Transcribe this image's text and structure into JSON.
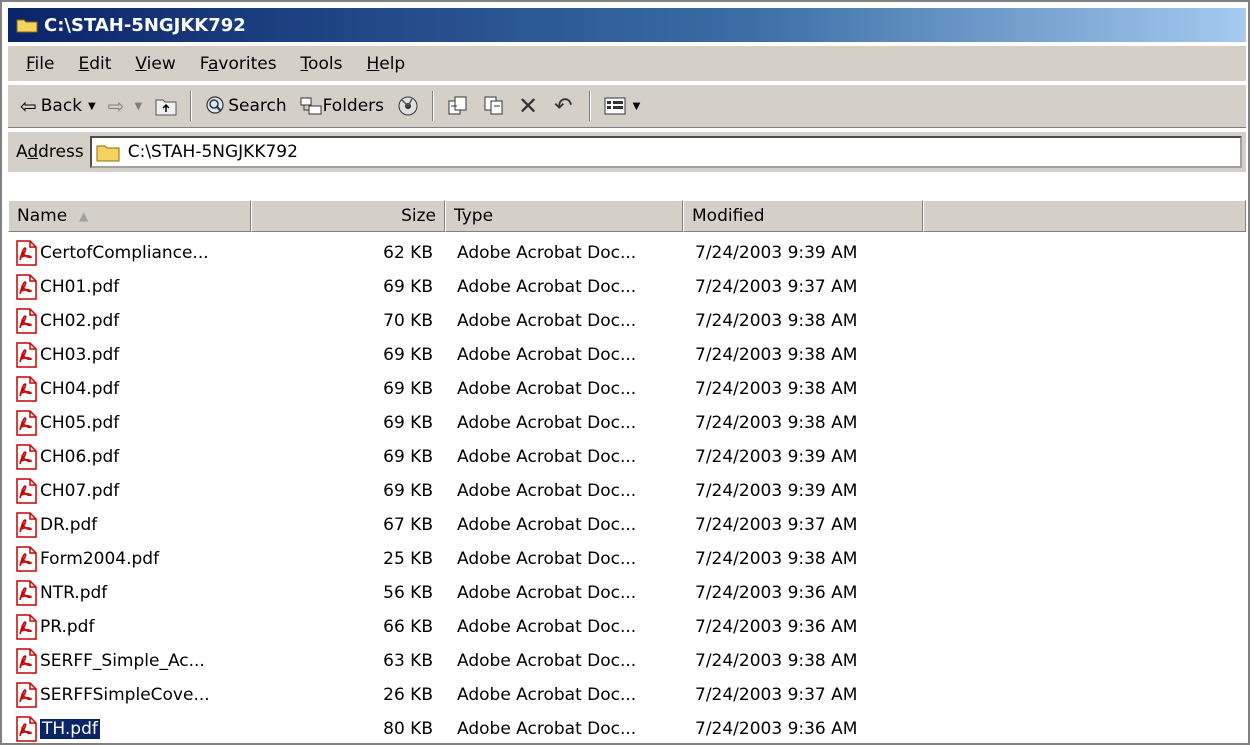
{
  "window": {
    "title": "C:\\STAH-5NGJKK792"
  },
  "menubar": {
    "items": [
      {
        "ul": "F",
        "rest": "ile"
      },
      {
        "ul": "E",
        "rest": "dit"
      },
      {
        "ul": "V",
        "rest": "iew"
      },
      {
        "pre": "F",
        "ul": "a",
        "rest": "vorites"
      },
      {
        "ul": "T",
        "rest": "ools"
      },
      {
        "ul": "H",
        "rest": "elp"
      }
    ]
  },
  "toolbar": {
    "back_label": "Back",
    "search_label": "Search",
    "folders_label": "Folders"
  },
  "address": {
    "label_pre": "A",
    "label_ul": "d",
    "label_rest": "dress",
    "value": "C:\\STAH-5NGJKK792"
  },
  "columns": {
    "name": "Name",
    "size": "Size",
    "type": "Type",
    "modified": "Modified"
  },
  "files": [
    {
      "name": "CertofCompliance...",
      "size": "62 KB",
      "type": "Adobe Acrobat Doc...",
      "modified": "7/24/2003 9:39 AM"
    },
    {
      "name": "CH01.pdf",
      "size": "69 KB",
      "type": "Adobe Acrobat Doc...",
      "modified": "7/24/2003 9:37 AM"
    },
    {
      "name": "CH02.pdf",
      "size": "70 KB",
      "type": "Adobe Acrobat Doc...",
      "modified": "7/24/2003 9:38 AM"
    },
    {
      "name": "CH03.pdf",
      "size": "69 KB",
      "type": "Adobe Acrobat Doc...",
      "modified": "7/24/2003 9:38 AM"
    },
    {
      "name": "CH04.pdf",
      "size": "69 KB",
      "type": "Adobe Acrobat Doc...",
      "modified": "7/24/2003 9:38 AM"
    },
    {
      "name": "CH05.pdf",
      "size": "69 KB",
      "type": "Adobe Acrobat Doc...",
      "modified": "7/24/2003 9:38 AM"
    },
    {
      "name": "CH06.pdf",
      "size": "69 KB",
      "type": "Adobe Acrobat Doc...",
      "modified": "7/24/2003 9:39 AM"
    },
    {
      "name": "CH07.pdf",
      "size": "69 KB",
      "type": "Adobe Acrobat Doc...",
      "modified": "7/24/2003 9:39 AM"
    },
    {
      "name": "DR.pdf",
      "size": "67 KB",
      "type": "Adobe Acrobat Doc...",
      "modified": "7/24/2003 9:37 AM"
    },
    {
      "name": "Form2004.pdf",
      "size": "25 KB",
      "type": "Adobe Acrobat Doc...",
      "modified": "7/24/2003 9:38 AM"
    },
    {
      "name": "NTR.pdf",
      "size": "56 KB",
      "type": "Adobe Acrobat Doc...",
      "modified": "7/24/2003 9:36 AM"
    },
    {
      "name": "PR.pdf",
      "size": "66 KB",
      "type": "Adobe Acrobat Doc...",
      "modified": "7/24/2003 9:36 AM"
    },
    {
      "name": "SERFF_Simple_Ac...",
      "size": "63 KB",
      "type": "Adobe Acrobat Doc...",
      "modified": "7/24/2003 9:38 AM"
    },
    {
      "name": "SERFFSimpleCove...",
      "size": "26 KB",
      "type": "Adobe Acrobat Doc...",
      "modified": "7/24/2003 9:37 AM"
    },
    {
      "name": "TH.pdf",
      "size": "80 KB",
      "type": "Adobe Acrobat Doc...",
      "modified": "7/24/2003 9:36 AM",
      "selected": true
    }
  ],
  "colors": {
    "title_bar": "#0a246a",
    "chrome": "#d4d0c8",
    "selection": "#0a246a",
    "pdf_red": "#cc0000"
  }
}
